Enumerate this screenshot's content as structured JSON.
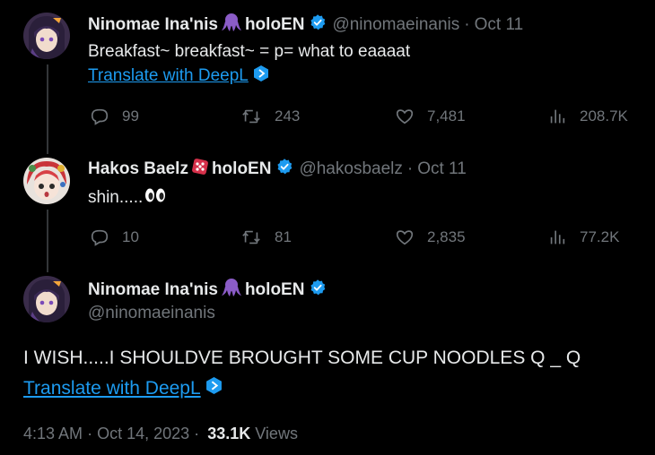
{
  "tweets": [
    {
      "name": "Ninomae Ina'nis",
      "org": "holoEN",
      "handle": "@ninomaeinanis",
      "date": "Oct 11",
      "text": "Breakfast~ breakfast~ = p= what to eaaaat",
      "translate": "Translate with DeepL",
      "replies": "99",
      "reposts": "243",
      "likes": "7,481",
      "views": "208.7K"
    },
    {
      "name": "Hakos Baelz",
      "org": "holoEN",
      "handle": "@hakosbaelz",
      "date": "Oct 11",
      "text": "shin.....",
      "replies": "10",
      "reposts": "81",
      "likes": "2,835",
      "views": "77.2K"
    }
  ],
  "main_tweet": {
    "name": "Ninomae Ina'nis",
    "org": "holoEN",
    "handle": "@ninomaeinanis",
    "text": "I WISH.....I SHOULDVE BROUGHT SOME CUP NOODLES Q _ Q",
    "translate": "Translate with DeepL",
    "time": "4:13 AM",
    "date": "Oct 14, 2023",
    "dot": "·",
    "views_count": "33.1K",
    "views_label": "Views"
  },
  "colors": {
    "accent": "#1d9bf0",
    "muted": "#71767b",
    "text": "#e7e9ea",
    "octopus": "#8b5cc7",
    "dice": "#d6304a"
  },
  "icons": [
    "reply-icon",
    "repost-icon",
    "like-icon",
    "views-icon",
    "verified-icon",
    "octopus-icon",
    "dice-icon",
    "eyes-icon",
    "deepl-icon"
  ]
}
